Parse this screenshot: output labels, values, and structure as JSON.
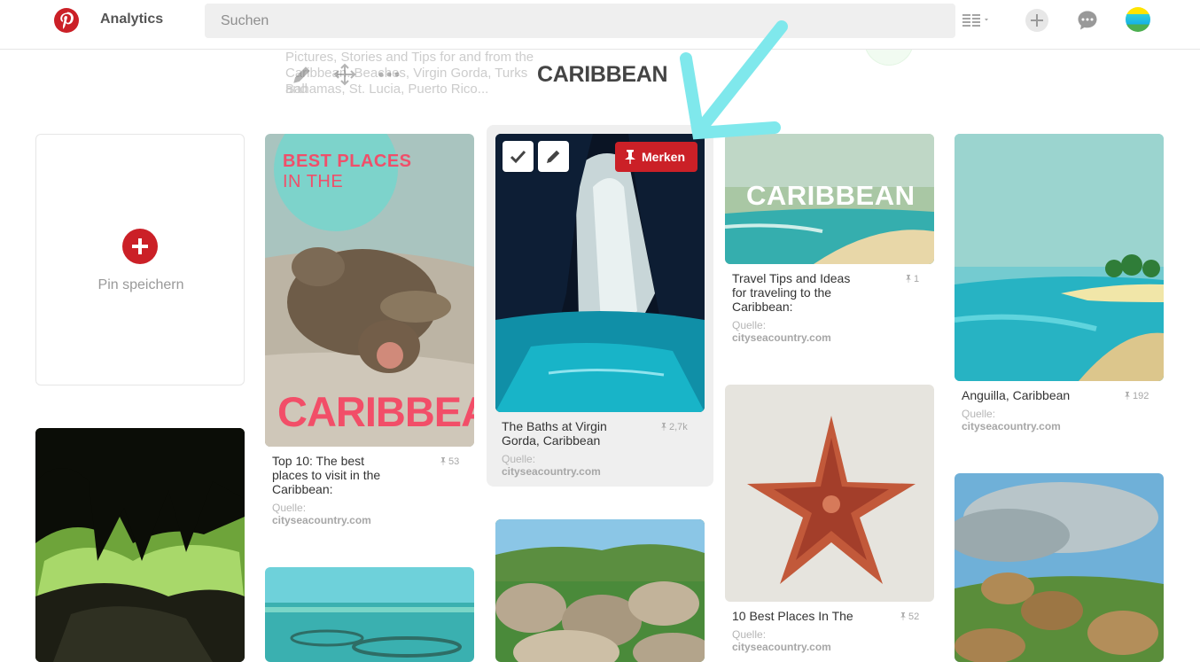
{
  "header": {
    "analytics_label": "Analytics",
    "search_placeholder": "Suchen"
  },
  "board": {
    "title": "CARIBBEAN",
    "description_line1": "Pictures, Stories and Tips for and from the",
    "description_line2": "Caribbean. Beaches, Virgin Gorda, Turks and",
    "description_line3": "Bahamas, St. Lucia, Puerto Rico..."
  },
  "save_card": {
    "label": "Pin speichern"
  },
  "pins": [
    {
      "img_text_top": "BEST PLACES",
      "img_text_mid": "IN THE",
      "img_text_bottom": "CARIBBEAN",
      "description": "Top 10: The best places to visit in the Caribbean:",
      "saves": "53",
      "source_label": "Quelle:",
      "source": "cityseacountry.com"
    },
    {
      "description": "The Baths at Virgin Gorda, Caribbean",
      "saves": "2,7k",
      "source_label": "Quelle:",
      "source": "cityseacountry.com",
      "merken_label": "Merken"
    },
    {
      "img_text": "CARIBBEAN",
      "description": "Travel Tips and Ideas for traveling to the Caribbean:",
      "saves": "1",
      "source_label": "Quelle:",
      "source": "cityseacountry.com"
    },
    {
      "description": "10 Best Places In The",
      "saves": "52",
      "source_label": "Quelle:",
      "source": "cityseacountry.com"
    },
    {
      "description": "Anguilla, Caribbean",
      "saves": "192",
      "source_label": "Quelle:",
      "source": "cityseacountry.com"
    }
  ],
  "colors": {
    "brand_red": "#cb2027",
    "arrow_cyan": "#7fe8ec"
  },
  "icons": [
    "pinterest-logo-icon",
    "list-view-icon",
    "plus-icon",
    "chat-icon",
    "edit-icon",
    "move-icon",
    "more-icon",
    "check-icon",
    "pencil-icon",
    "pushpin-icon"
  ]
}
